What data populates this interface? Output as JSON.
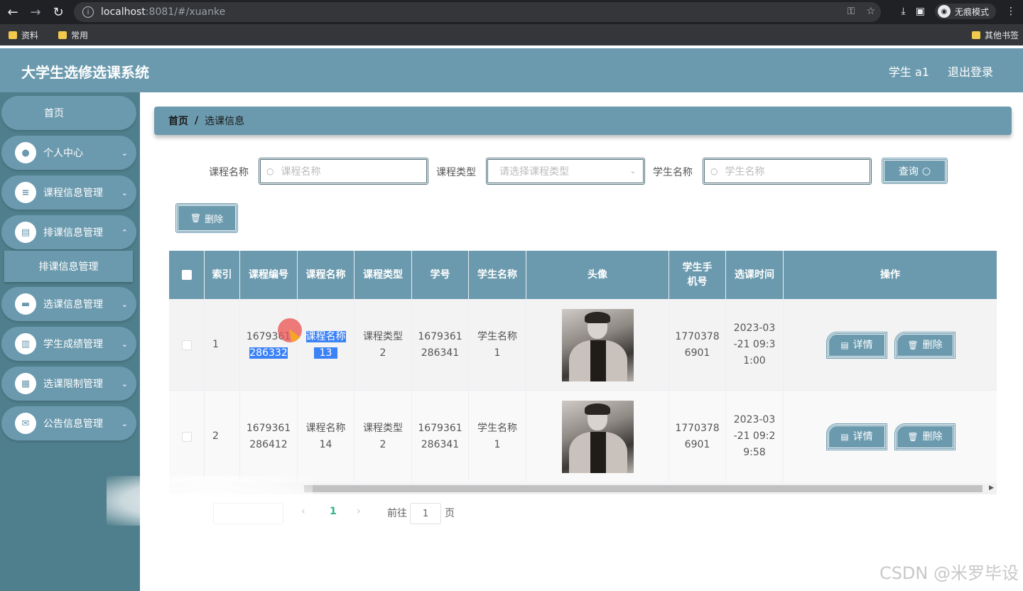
{
  "browser": {
    "url_host": "localhost",
    "url_path": ":8081/#/xuanke",
    "incognito_label": "无痕模式",
    "bookmarks": [
      "资料",
      "常用"
    ],
    "bookmarks_right": "其他书签"
  },
  "header": {
    "title": "大学生选修选课系统",
    "user": "学生 a1",
    "logout": "退出登录"
  },
  "sidebar": {
    "home": "首页",
    "items": [
      {
        "label": "个人中心",
        "icon": "user-icon"
      },
      {
        "label": "课程信息管理",
        "icon": "list-icon"
      },
      {
        "label": "排课信息管理",
        "icon": "briefcase-icon"
      },
      {
        "label": "选课信息管理",
        "icon": "chat-icon"
      },
      {
        "label": "学生成绩管理",
        "icon": "clipboard-icon"
      },
      {
        "label": "选课限制管理",
        "icon": "grid-icon"
      },
      {
        "label": "公告信息管理",
        "icon": "ticket-icon"
      }
    ],
    "submenu_label": "排课信息管理"
  },
  "breadcrumb": {
    "home": "首页",
    "separator": "/",
    "current": "选课信息"
  },
  "search": {
    "course_name_label": "课程名称",
    "course_name_placeholder": "课程名称",
    "course_type_label": "课程类型",
    "course_type_placeholder": "请选择课程类型",
    "student_name_label": "学生名称",
    "student_name_placeholder": "学生名称",
    "query_button": "查询"
  },
  "toolbar": {
    "delete_button": "删除"
  },
  "table": {
    "headers": [
      "索引",
      "课程编号",
      "课程名称",
      "课程类型",
      "学号",
      "学生名称",
      "头像",
      "学生手机号",
      "选课时间",
      "操作"
    ],
    "rows": [
      {
        "index": "1",
        "course_no_a": "1679361",
        "course_no_b": "286332",
        "course_name_a": "课程名称",
        "course_name_b": "13",
        "course_type_a": "课程类型",
        "course_type_b": "2",
        "student_no_a": "1679361",
        "student_no_b": "286341",
        "student_name_a": "学生名称",
        "student_name_b": "1",
        "phone_a": "1770378",
        "phone_b": "6901",
        "time_a": "2023-03",
        "time_b": "-21 09:3",
        "time_c": "1:00"
      },
      {
        "index": "2",
        "course_no_a": "1679361",
        "course_no_b": "286412",
        "course_name_a": "课程名称",
        "course_name_b": "14",
        "course_type_a": "课程类型",
        "course_type_b": "2",
        "student_no_a": "1679361",
        "student_no_b": "286341",
        "student_name_a": "学生名称",
        "student_name_b": "1",
        "phone_a": "1770378",
        "phone_b": "6901",
        "time_a": "2023-03",
        "time_b": "-21 09:2",
        "time_c": "9:58"
      }
    ],
    "detail_button": "详情",
    "delete_button": "删除"
  },
  "pagination": {
    "current_page": "1",
    "goto_label": "前往",
    "goto_value": "1",
    "page_suffix": "页"
  },
  "watermark": "CSDN @米罗毕设",
  "colors": {
    "accent": "#6b9aae",
    "sidebar_bg": "#4f7f8c",
    "highlight": "#3b82f6"
  }
}
